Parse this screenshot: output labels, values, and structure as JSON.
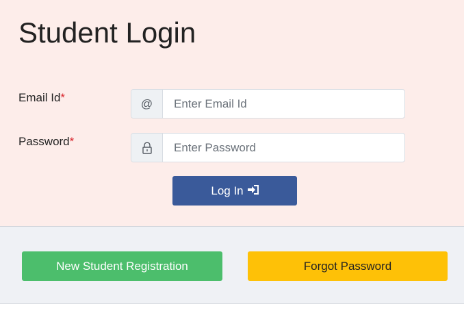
{
  "page": {
    "title": "Student Login"
  },
  "form": {
    "email": {
      "label": "Email Id",
      "required_mark": "*",
      "icon_text": "@",
      "placeholder": "Enter Email Id",
      "value": ""
    },
    "password": {
      "label": "Password",
      "required_mark": "*",
      "icon": "lock-icon",
      "placeholder": "Enter Password",
      "value": ""
    },
    "login_label": "Log In",
    "login_icon": "sign-in-icon"
  },
  "footer": {
    "register_label": "New Student Registration",
    "forgot_label": "Forgot Password"
  },
  "colors": {
    "top_bg": "#fdedea",
    "bottom_bg": "#eff1f5",
    "login_btn": "#3a5a9a",
    "register_btn": "#4cbe6c",
    "forgot_btn": "#fec107",
    "required": "#d9262d"
  }
}
